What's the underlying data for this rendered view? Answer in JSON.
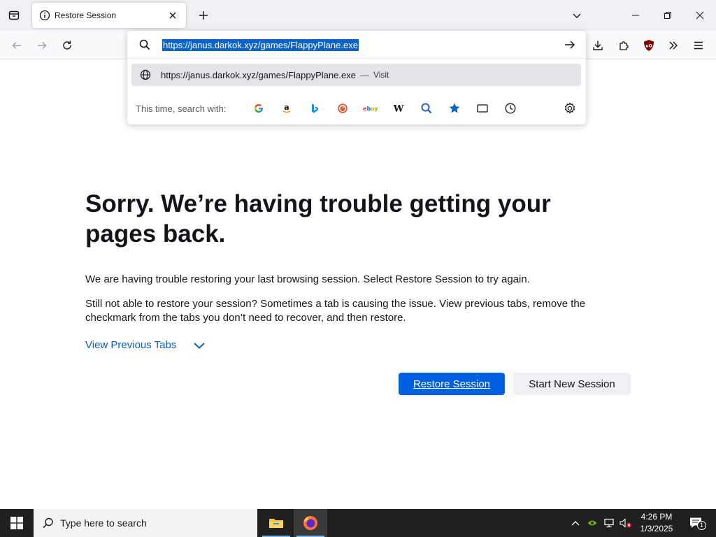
{
  "browser": {
    "tab": {
      "title": "Restore Session"
    },
    "urlbar": {
      "value": "https://janus.darkok.xyz/games/FlappyPlane.exe",
      "suggestion_url": "https://janus.darkok.xyz/games/FlappyPlane.exe",
      "suggestion_separator": "—",
      "suggestion_action": "Visit",
      "search_with_label": "This time, search with:",
      "engines": [
        "google-icon",
        "amazon-icon",
        "bing-icon",
        "duckduckgo-icon",
        "ebay-icon",
        "wikipedia-icon",
        "search-icon",
        "bookmarks-icon",
        "tabs-icon",
        "history-icon"
      ]
    }
  },
  "page": {
    "heading": "Sorry. We’re having trouble getting your pages back.",
    "para1": "We are having trouble restoring your last browsing session. Select Restore Session to try again.",
    "para2": "Still not able to restore your session? Sometimes a tab is causing the issue. View previous tabs, remove the checkmark from the tabs you don’t need to recover, and then restore.",
    "view_previous_tabs": "View Previous Tabs",
    "restore_button": "Restore Session",
    "new_session_button": "Start New Session"
  },
  "taskbar": {
    "search_placeholder": "Type here to search",
    "time": "4:26 PM",
    "date": "1/3/2025",
    "notification_count": "1"
  },
  "colors": {
    "accent": "#0061e0",
    "link": "#0a5ebe",
    "selection": "#0a63c9"
  }
}
